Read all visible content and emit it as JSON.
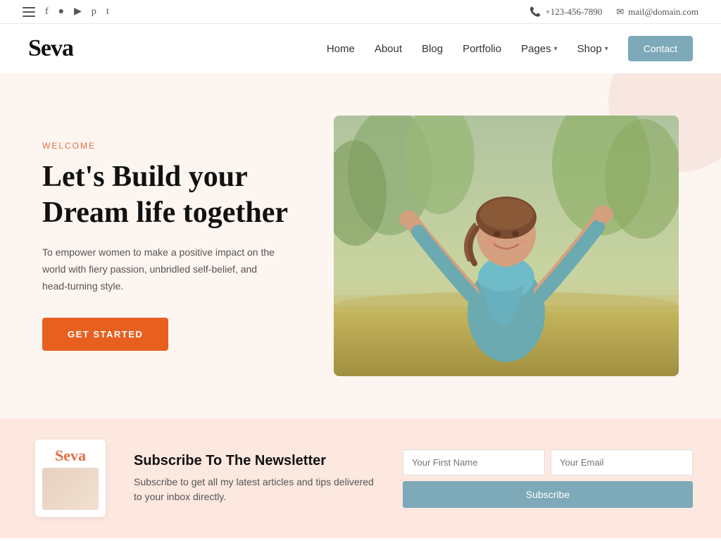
{
  "topbar": {
    "phone": "+123-456-7890",
    "email": "mail@domain.com",
    "social_icons": [
      "hamburger",
      "facebook",
      "instagram",
      "youtube",
      "pinterest",
      "twitter"
    ]
  },
  "nav": {
    "logo": "Seva",
    "links": [
      {
        "label": "Home",
        "dropdown": false
      },
      {
        "label": "About",
        "dropdown": false
      },
      {
        "label": "Blog",
        "dropdown": false
      },
      {
        "label": "Portfolio",
        "dropdown": false
      },
      {
        "label": "Pages",
        "dropdown": true
      },
      {
        "label": "Shop",
        "dropdown": true
      }
    ],
    "contact_btn": "Contact"
  },
  "hero": {
    "welcome_label": "Welcome",
    "title_line1": "Let's Build your",
    "title_line2": "Dream life together",
    "description": "To empower women to make a positive impact on the world with fiery passion, unbridled self-belief, and head-turning style.",
    "cta_label": "GET STARTED"
  },
  "subscribe": {
    "logo": "Seva",
    "title": "Subscribe To The Newsletter",
    "description": "Subscribe to get all my latest articles and tips delivered to your inbox directly.",
    "name_placeholder": "Your First Name",
    "email_placeholder": "Your Email",
    "btn_label": "Subscribe"
  },
  "colors": {
    "accent_orange": "#e86020",
    "accent_teal": "#7da9b8",
    "welcome_color": "#e07040",
    "logo_color": "#111",
    "hero_bg": "#fdf5f0",
    "subscribe_bg": "#fde8e0"
  }
}
